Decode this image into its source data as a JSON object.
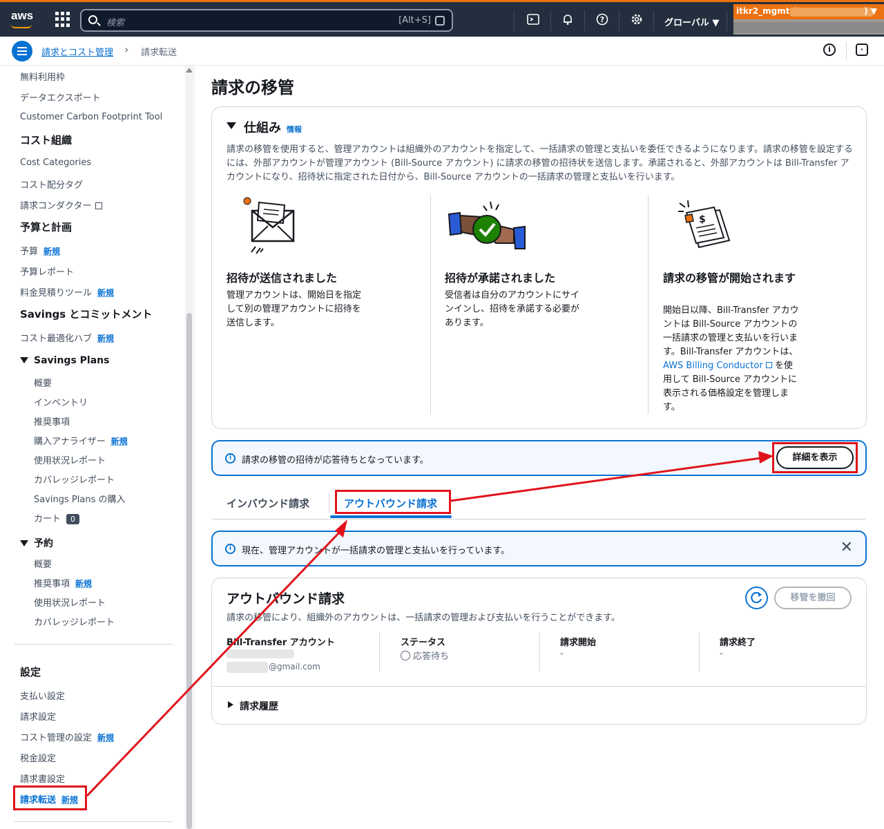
{
  "topbar": {
    "logo": "aws",
    "search_placeholder": "検索",
    "search_shortcut": "[Alt+S]",
    "region": "グローバル ▼",
    "account_name": "itkr2_mgmt (",
    "account_suffix": ") ▼",
    "icons": [
      "cloudshell-icon",
      "bell-icon",
      "help-icon",
      "gear-icon"
    ]
  },
  "breadcrumb": {
    "parent": "請求とコスト管理",
    "current": "請求転送"
  },
  "sidebar": {
    "free_tier": "無料利用枠",
    "data_export": "データエクスポート",
    "carbon_tool": "Customer Carbon Footprint Tool",
    "cost_org": "コスト組織",
    "cost_categories": "Cost Categories",
    "cost_alloc_tags": "コスト配分タグ",
    "billing_conductor": "請求コンダクター",
    "budget_planning": "予算と計画",
    "budgets": "予算",
    "budget_reports": "予算レポート",
    "pricing_calc": "料金見積りツール",
    "savings_commit": "Savings とコミットメント",
    "cost_opt_hub": "コスト最適化ハブ",
    "savings_plans": "Savings Plans",
    "sp_overview": "概要",
    "sp_inventory": "インベントリ",
    "sp_recommendations": "推奨事項",
    "sp_purchase_analyzer": "購入アナライザー",
    "sp_utilization": "使用状況レポート",
    "sp_coverage": "カバレッジレポート",
    "sp_purchase": "Savings Plans の購入",
    "sp_cart": "カート",
    "sp_cart_count": "0",
    "reservations": "予約",
    "ri_overview": "概要",
    "ri_recommendations": "推奨事項",
    "ri_utilization": "使用状況レポート",
    "ri_coverage": "カバレッジレポート",
    "settings": "設定",
    "payment_prefs": "支払い設定",
    "billing_prefs": "請求設定",
    "cost_mgmt_prefs": "コスト管理の設定",
    "tax_settings": "税金設定",
    "invoice_settings": "請求書設定",
    "billing_transfer": "請求転送",
    "new_label": "新規"
  },
  "page": {
    "title": "請求の移管",
    "how_it_works": {
      "title": "仕組み",
      "info": "情報",
      "description": "請求の移管を使用すると、管理アカウントは組織外のアカウントを指定して、一括請求の管理と支払いを委任できるようになります。請求の移管を設定するには、外部アカウントが管理アカウント (Bill-Source アカウント) に請求の移管の招待状を送信します。承諾されると、外部アカウントは Bill-Transfer アカウントになり、招待状に指定された日付から、Bill-Source アカウントの一括請求の管理と支払いを行います。",
      "steps": [
        {
          "title": "招待が送信されました",
          "text": "管理アカウントは、開始日を指定して別の管理アカウントに招待を送信します。"
        },
        {
          "title": "招待が承諾されました",
          "text": "受信者は自分のアカウントにサインインし、招待を承諾する必要があります。"
        },
        {
          "title": "請求の移管が開始されます",
          "text_a": "開始日以降、Bill-Transfer アカウントは Bill-Source アカウントの一括請求の管理と支払いを行います。Bill-Transfer アカウントは、",
          "link": "AWS Billing Conductor",
          "text_b": " を使用して Bill-Source アカウントに表示される価格設定を管理します。"
        }
      ]
    },
    "pending_alert": "請求の移管の招待が応答待ちとなっています。",
    "view_details": "詳細を表示",
    "tabs": [
      "インバウンド請求",
      "アウトバウンド請求"
    ],
    "info_alert": "現在、管理アカウントが一括請求の管理と支払いを行っています。",
    "outbound": {
      "title": "アウトバウンド請求",
      "description": "請求の移管により、組織外のアカウントは、一括請求の管理および支払いを行うことができます。",
      "revoke": "移管を撤回",
      "col_account": "Bill-Transfer アカウント",
      "account_email": "@gmail.com",
      "col_status": "ステータス",
      "status_value": "応答待ち",
      "col_start": "請求開始",
      "start_value": "-",
      "col_end": "請求終了",
      "end_value": "-",
      "history": "請求履歴"
    }
  },
  "colors": {
    "accent": "#0972d3",
    "annotation": "#e0121b",
    "topbar": "#232f3e"
  }
}
